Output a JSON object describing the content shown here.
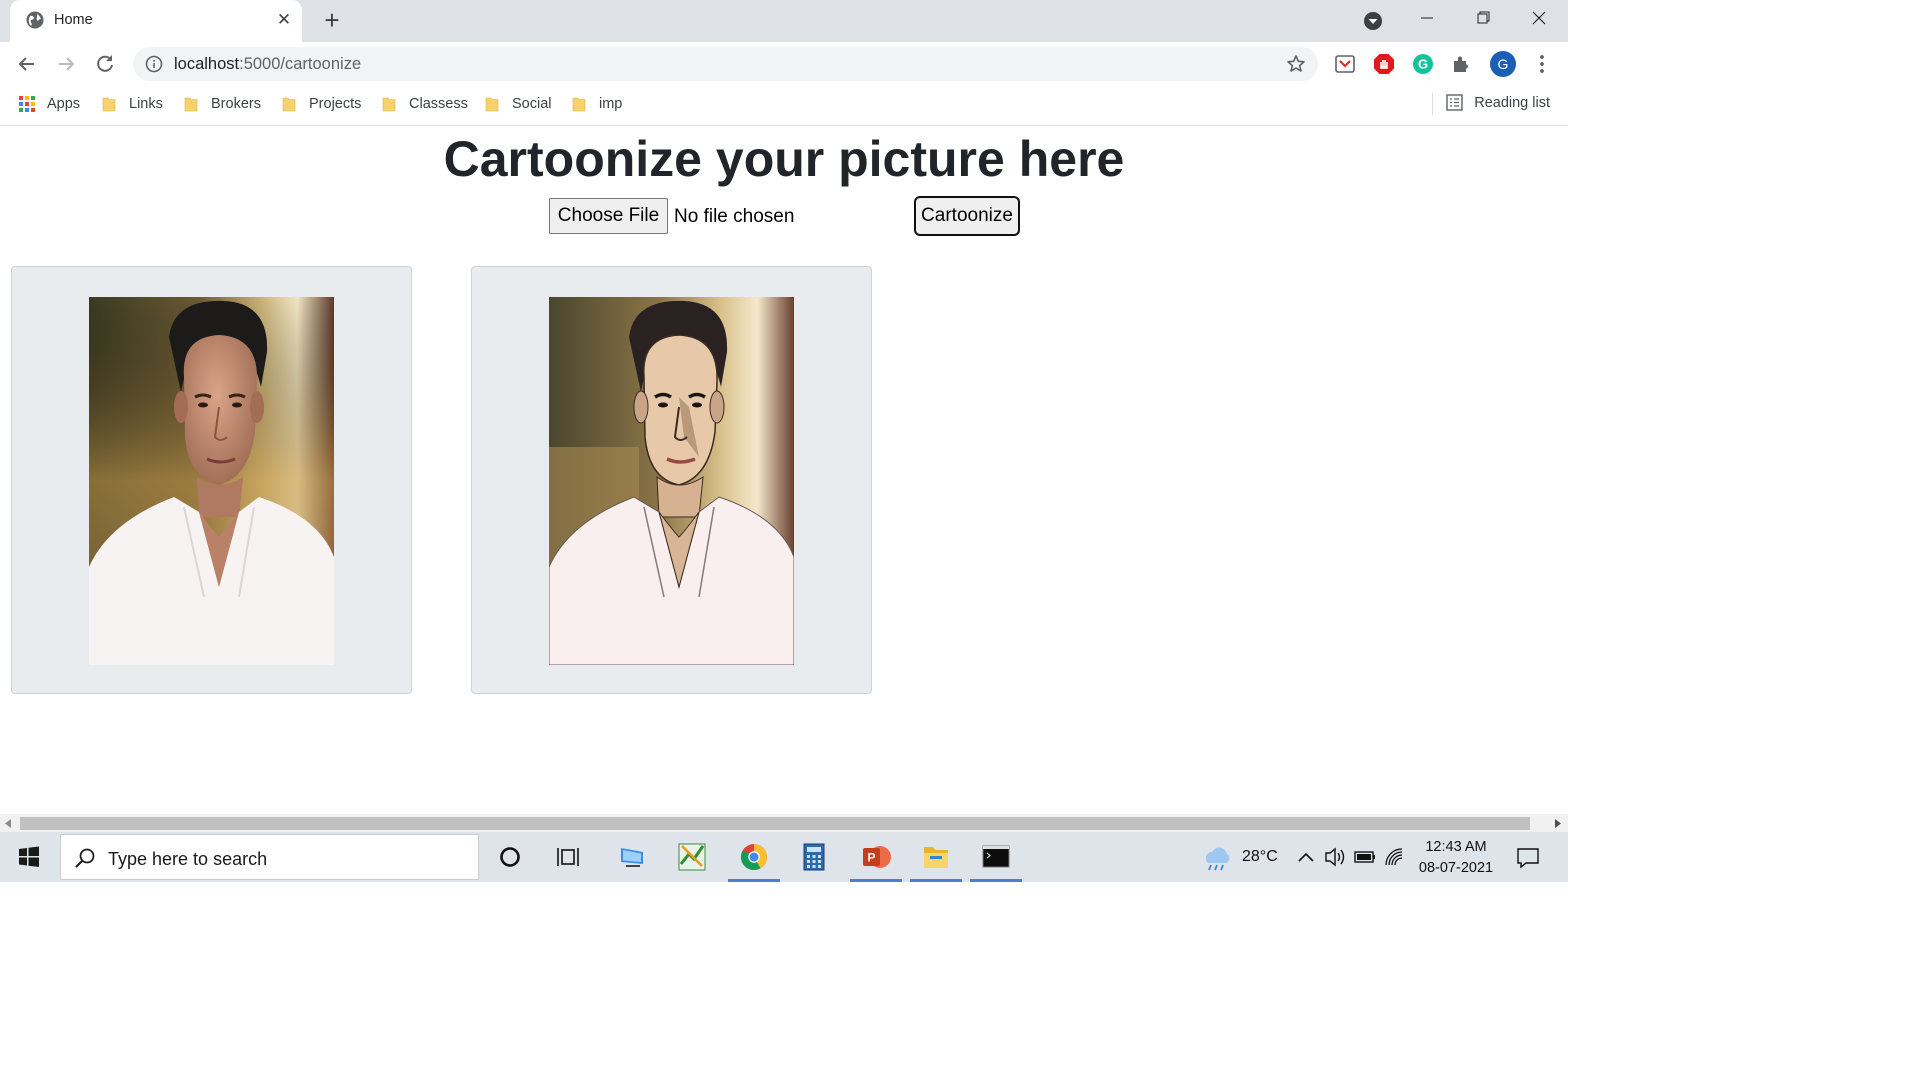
{
  "browser": {
    "tab": {
      "title": "Home",
      "favicon": "globe-icon"
    },
    "url": {
      "host": "localhost",
      "path": ":5000/cartoonize"
    },
    "profile_initial": "G",
    "extension_initial": "G"
  },
  "bookmarks": {
    "items": [
      {
        "label": "Apps",
        "icon": "apps-grid-icon"
      },
      {
        "label": "Links",
        "icon": "folder-icon"
      },
      {
        "label": "Brokers",
        "icon": "folder-icon"
      },
      {
        "label": "Projects",
        "icon": "folder-icon"
      },
      {
        "label": "Classess",
        "icon": "folder-icon"
      },
      {
        "label": "Social",
        "icon": "folder-icon"
      },
      {
        "label": "imp",
        "icon": "folder-icon"
      }
    ],
    "reading_list": "Reading list"
  },
  "page": {
    "heading": "Cartoonize your picture here",
    "choose_file_label": "Choose File",
    "file_status": "No file chosen",
    "submit_label": "Cartoonize"
  },
  "taskbar": {
    "search_placeholder": "Type here to search",
    "temperature": "28°C",
    "time": "12:43 AM",
    "date": "08-07-2021"
  },
  "colors": {
    "page_heading": "#212529",
    "card_background": "#e9ecef",
    "chrome_frame": "#dee1e6",
    "taskbar": "#dfe3ea",
    "taskbar_active": "#4a7fd1"
  }
}
